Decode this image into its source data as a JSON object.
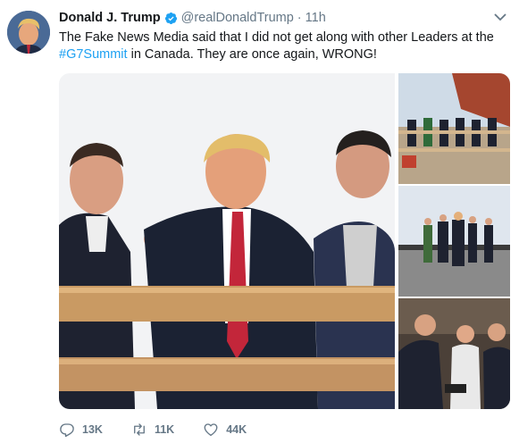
{
  "tweet": {
    "display_name": "Donald J. Trump",
    "handle": "@realDonaldTrump",
    "separator": "·",
    "time": "11h",
    "text_before": "The Fake News Media said that I did not get along with other Leaders at the ",
    "hashtag": "#G7Summit",
    "text_after": " in Canada. They are once again, WRONG!"
  },
  "actions": {
    "reply_count": "13K",
    "retweet_count": "11K",
    "like_count": "44K"
  },
  "icons": {
    "verified": "verified-badge-icon",
    "chevron": "chevron-down-icon",
    "reply": "reply-icon",
    "retweet": "retweet-icon",
    "like": "heart-icon"
  },
  "colors": {
    "link": "#1da1f2",
    "secondary_text": "#657786",
    "primary_text": "#14171a"
  }
}
